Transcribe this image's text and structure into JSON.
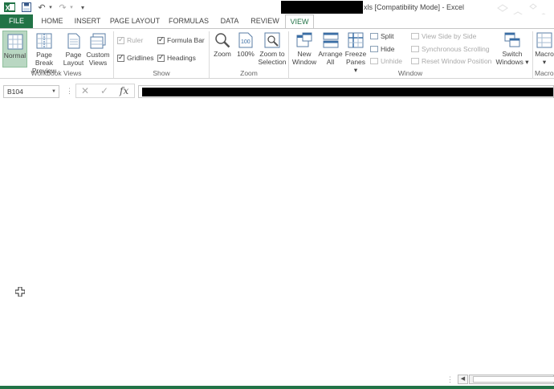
{
  "title_bar": {
    "title_suffix": "xls  [Compatibility Mode] - Excel",
    "qat": {
      "excel_logo": "X",
      "save_icon": "floppy-icon",
      "undo": "↶",
      "redo": "↷",
      "customize": "▾"
    }
  },
  "tabs": [
    "FILE",
    "HOME",
    "INSERT",
    "PAGE LAYOUT",
    "FORMULAS",
    "DATA",
    "REVIEW",
    "VIEW"
  ],
  "ribbon": {
    "workbook_views": {
      "label": "Workbook Views",
      "normal": "Normal",
      "page_break": [
        "Page Break",
        "Preview"
      ],
      "page_layout": [
        "Page",
        "Layout"
      ],
      "custom_views": [
        "Custom",
        "Views"
      ]
    },
    "show": {
      "label": "Show",
      "ruler": "Ruler",
      "formula_bar": "Formula Bar",
      "gridlines": "Gridlines",
      "headings": "Headings"
    },
    "zoom": {
      "label": "Zoom",
      "zoom": "Zoom",
      "hundred": "100%",
      "zoom_selection": [
        "Zoom to",
        "Selection"
      ]
    },
    "window": {
      "label": "Window",
      "new_window": [
        "New",
        "Window"
      ],
      "arrange_all": [
        "Arrange",
        "All"
      ],
      "freeze_panes": [
        "Freeze",
        "Panes ▾"
      ],
      "split": "Split",
      "hide": "Hide",
      "unhide": "Unhide",
      "side_by_side": "View Side by Side",
      "sync_scroll": "Synchronous Scrolling",
      "reset_position": "Reset Window Position",
      "switch_windows": [
        "Switch",
        "Windows ▾"
      ]
    },
    "macros": {
      "label": "Macro",
      "macros": [
        "Macro",
        "▾"
      ]
    }
  },
  "formula_bar": {
    "name_box": "B104",
    "grip": "⋮",
    "cancel": "✕",
    "enter": "✓",
    "fx": "fx"
  },
  "bottom": {
    "grip": "⋮",
    "scroll_left": "◀"
  }
}
